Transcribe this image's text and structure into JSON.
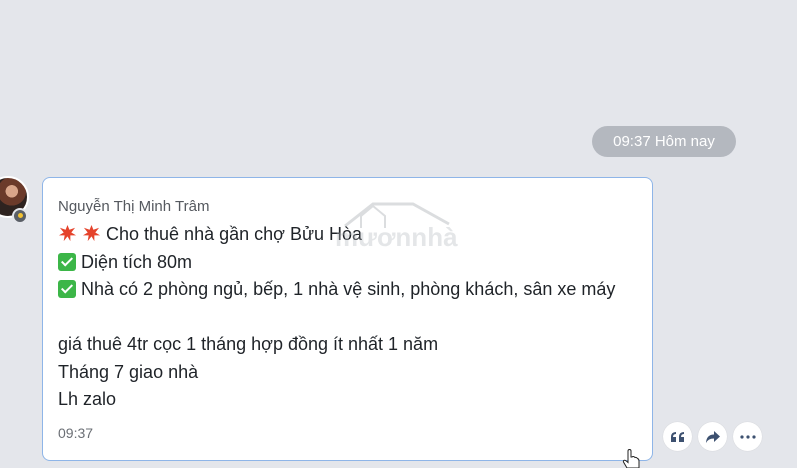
{
  "date_divider": {
    "label": "09:37 Hôm nay"
  },
  "message": {
    "sender": "Nguyễn Thị Minh Trâm",
    "lines": [
      {
        "icon": "anger-icon",
        "text": "Cho thuê nhà gần chợ Bửu Hòa"
      },
      {
        "icon": "check-mark-icon",
        "text": "Diện tích 80m"
      },
      {
        "icon": "check-mark-icon",
        "text": "Nhà có 2 phòng ngủ, bếp, 1 nhà vệ sinh, phòng khách, sân xe máy"
      },
      {
        "icon": null,
        "text": ""
      },
      {
        "icon": null,
        "text": "giá thuê 4tr cọc 1 tháng hợp đồng ít nhất 1 năm"
      },
      {
        "icon": null,
        "text": "Tháng 7 giao nhà"
      },
      {
        "icon": null,
        "text": "Lh zalo"
      }
    ],
    "time": "09:37"
  },
  "actions": [
    {
      "name": "quote-icon"
    },
    {
      "name": "forward-icon"
    },
    {
      "name": "more-icon"
    }
  ],
  "colors": {
    "background": "#e4e6eb",
    "bubble_border": "#8eb5e8",
    "check": "#3cb648",
    "anger": "#e5432b"
  }
}
